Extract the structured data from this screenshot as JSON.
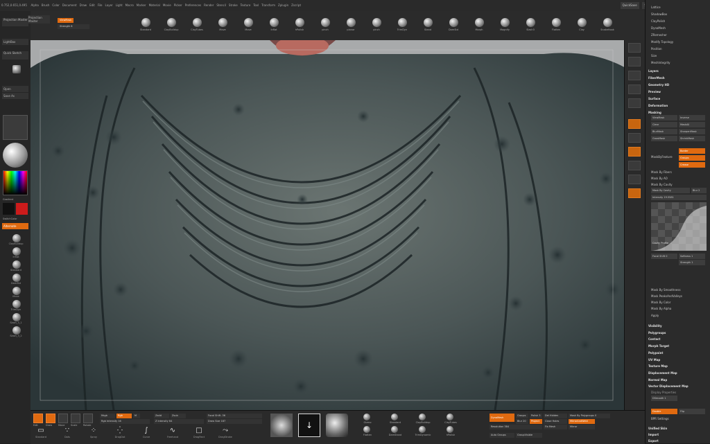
{
  "app": {
    "coords": "0.752,0.651,0.495",
    "menu": [
      "Alpha",
      "Brush",
      "Color",
      "Document",
      "Draw",
      "Edit",
      "File",
      "Layer",
      "Light",
      "Macro",
      "Marker",
      "Material",
      "Movie",
      "Picker",
      "Preferences",
      "Render",
      "Stencil",
      "Stroke",
      "Texture",
      "Tool",
      "Transform",
      "Zplugin",
      "Zscript"
    ],
    "quicksave": "QuickSave",
    "see_through": "See-through 0",
    "menus_btn": "Menus",
    "default_script": "DefaultZScript"
  },
  "left": {
    "projection": "Projection Master",
    "lightbox": "LightBox",
    "quick_sketch": "Quick Sketch",
    "open": "Open",
    "save_as": "Save As",
    "gradient": "Gradient",
    "switch_color": "SwitchColor",
    "alternate": "Alternate",
    "alphas": [
      "ClayBuildup",
      "Inflat",
      "Standard",
      "DamStd",
      "Move",
      "TrimDyn",
      "Slash_3_1",
      "Slash_3_2"
    ],
    "colors": {
      "primary": "#111111",
      "secondary": "#cc1b1b"
    }
  },
  "toolstrip": {
    "viewmask": "ViewMask",
    "strength": "Strength 8",
    "brushes": [
      "Standard",
      "ClayBuildup",
      "ClayTubes",
      "Move",
      "Move",
      "Inflat",
      "hPolish",
      "pinch",
      "planar",
      "pinch",
      "TrimDyn",
      "Stand",
      "DamStd",
      "Morph",
      "Magnify",
      "Slash3",
      "Flatten",
      "Clay",
      "SnakeHook"
    ]
  },
  "rshelf": {
    "labels": [
      "Persp",
      "Floor",
      "Local",
      "Frame",
      "Move",
      "Scale",
      "Rotate",
      "PolyF",
      "Transp",
      "Solo",
      "Xpose"
    ]
  },
  "right": {
    "tool_items": [
      "Lattice",
      "ShadowBox",
      "ClayPolish",
      "DynaMesh",
      "ZRemesher",
      "Modify Topology",
      "Position",
      "Size",
      "MeshIntegrity"
    ],
    "sections": [
      "Layers",
      "FiberMesh",
      "Geometry HD",
      "Preview",
      "Surface",
      "Deformation",
      "Masking"
    ],
    "masking": {
      "view_mask": "ViewMask",
      "inverse": "Inverse",
      "clear": "Clear",
      "mask_all": "MaskAll",
      "blur_mask": "BlurMask",
      "sharpen_mask": "SharpenMask",
      "grow_mask": "GrowMask",
      "shrink_mask": "ShrinkMask",
      "mask_by_feature": "MaskByFeature",
      "border": "Border",
      "groups": "Groups",
      "crease": "Crease",
      "by_fibers": "Mask By Fibers",
      "by_ao": "Mask By AO",
      "by_cavity": "Mask By Cavity",
      "mask_by_cavity": "Mask By Cavity",
      "blur": "Blur 2",
      "intensity": "Intensity 19.5581",
      "cavity_profile": "Cavity Profile",
      "focal_shift": "Focal Shift 0",
      "softness": "Softness 1",
      "strength": "Strength 1",
      "by_smoothness": "Mask By Smoothness",
      "peaks_valleys": "Mask PeaksAndValleys",
      "by_color": "Mask By Color",
      "by_alpha": "Mask By Alpha",
      "apply": "Apply"
    },
    "sections2": [
      "Visibility",
      "Polygroups",
      "Contact",
      "Morph Target",
      "Polypaint",
      "UV Map",
      "Texture Map",
      "Displacement Map",
      "Normal Map",
      "Vector Displacement Map"
    ],
    "display": {
      "title": "Display Properties",
      "dsmooth": "DSmooth 1",
      "bpr": "BPR Settings",
      "double": "Double",
      "flip": "Flip"
    },
    "unified": "Unified Skin",
    "import": "Import",
    "export": "Export"
  },
  "bottom": {
    "edit": "Edit",
    "draw": "Draw",
    "move": "Move",
    "scale": "Scale",
    "rotate": "Rotate",
    "mrgb": "Mrgb",
    "rgb": "Rgb",
    "m": "M",
    "zadd": "Zadd",
    "zsub": "Zsub",
    "rgb_intensity": "Rgb Intensity 16",
    "z_intensity": "Z Intensity 64",
    "focal_shift": "Focal Shift -36",
    "draw_size": "Draw Size 187",
    "strokes": [
      "Standard",
      "Dots",
      "Spray",
      "DragDot",
      "Curve",
      "Freehand",
      "DragRect",
      "DragStroke"
    ],
    "dyn_brushes": [
      "Gizmo",
      "Standard",
      "ClayBuildup",
      "ClayTubes",
      "Flatten",
      "DamStand",
      "TrimDynamic",
      "hPolish"
    ],
    "dynamesh": "DynaMesh",
    "groups": "Groups",
    "polish": "Polish 3",
    "blur": "Blur 20",
    "resolution": "Resolution 384",
    "project": "Project",
    "del_hidden": "Del Hidden",
    "close_holes": "Close Holes",
    "fix_mesh": "Fix Mesh",
    "mask_by_polygroups": "Mask By Polygroups 0",
    "mirror_and_weld": "MirrorAndWeld",
    "auto_groups": "Auto Groups",
    "group_visible": "GroupVisible",
    "mirror": "Mirror"
  }
}
